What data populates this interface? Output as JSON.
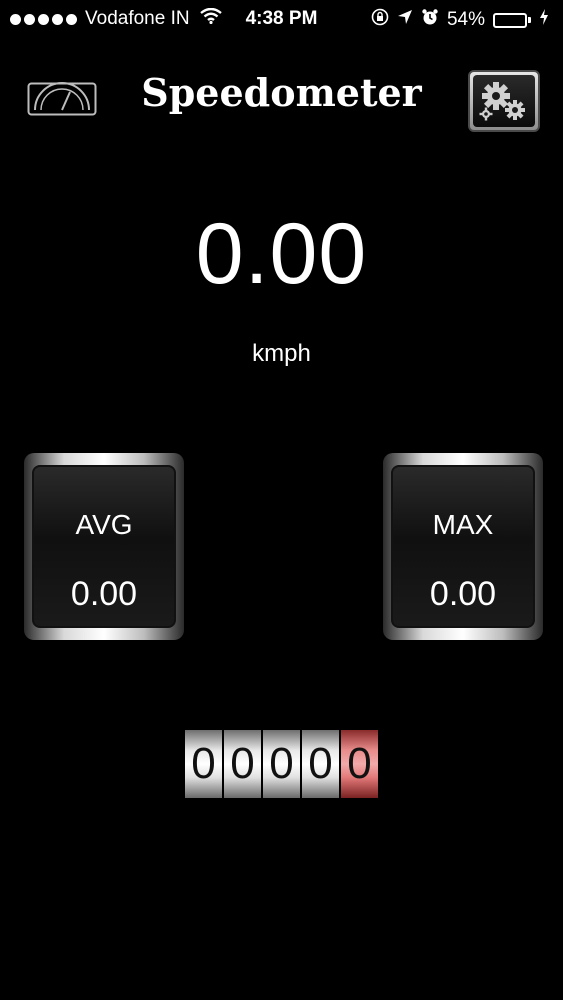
{
  "status_bar": {
    "carrier": "Vodafone IN",
    "time": "4:38 PM",
    "battery_percent": "54%",
    "battery_level": 0.54,
    "battery_color": "#35d442",
    "icons": [
      "signal-dots",
      "wifi-icon",
      "orientation-lock-icon",
      "location-arrow-icon",
      "alarm-icon",
      "battery-icon",
      "charging-bolt-icon"
    ]
  },
  "header": {
    "title": "Speedometer",
    "left_icon": "gauge-icon",
    "right_icon": "gear-icon"
  },
  "speed": {
    "value": "0.00",
    "unit": "kmph"
  },
  "stats": {
    "avg": {
      "label": "AVG",
      "value": "0.00"
    },
    "max": {
      "label": "MAX",
      "value": "0.00"
    }
  },
  "odometer": {
    "digits": [
      "0",
      "0",
      "0",
      "0",
      "0"
    ],
    "last_digit_color": "#e46a6a"
  }
}
